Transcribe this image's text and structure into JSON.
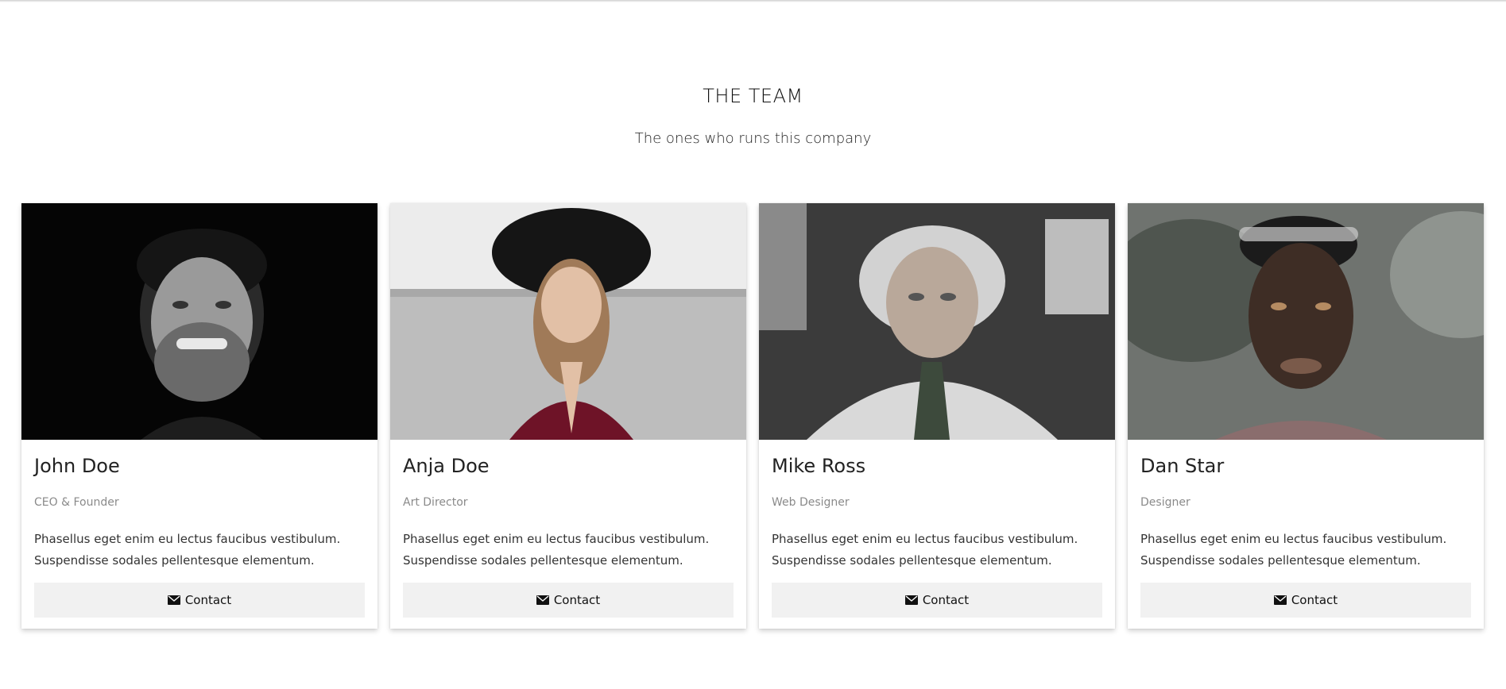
{
  "section": {
    "title": "THE TEAM",
    "subtitle": "The ones who runs this company"
  },
  "team": [
    {
      "name": "John Doe",
      "role": "CEO & Founder",
      "desc_line1": "Phasellus eget enim eu lectus faucibus vestibulum.",
      "desc_line2": "Suspendisse sodales pellentesque elementum.",
      "button_label": "Contact",
      "photo_icon": "portrait-photo"
    },
    {
      "name": "Anja Doe",
      "role": "Art Director",
      "desc_line1": "Phasellus eget enim eu lectus faucibus vestibulum.",
      "desc_line2": "Suspendisse sodales pellentesque elementum.",
      "button_label": "Contact",
      "photo_icon": "portrait-photo"
    },
    {
      "name": "Mike Ross",
      "role": "Web Designer",
      "desc_line1": "Phasellus eget enim eu lectus faucibus vestibulum.",
      "desc_line2": "Suspendisse sodales pellentesque elementum.",
      "button_label": "Contact",
      "photo_icon": "portrait-photo"
    },
    {
      "name": "Dan Star",
      "role": "Designer",
      "desc_line1": "Phasellus eget enim eu lectus faucibus vestibulum.",
      "desc_line2": "Suspendisse sodales pellentesque elementum.",
      "button_label": "Contact",
      "photo_icon": "portrait-photo"
    }
  ],
  "colors": {
    "background": "#ffffff",
    "button_bg": "#f1f1f1",
    "role_text": "#8a8a8a"
  },
  "icons": {
    "contact": "envelope-icon"
  }
}
